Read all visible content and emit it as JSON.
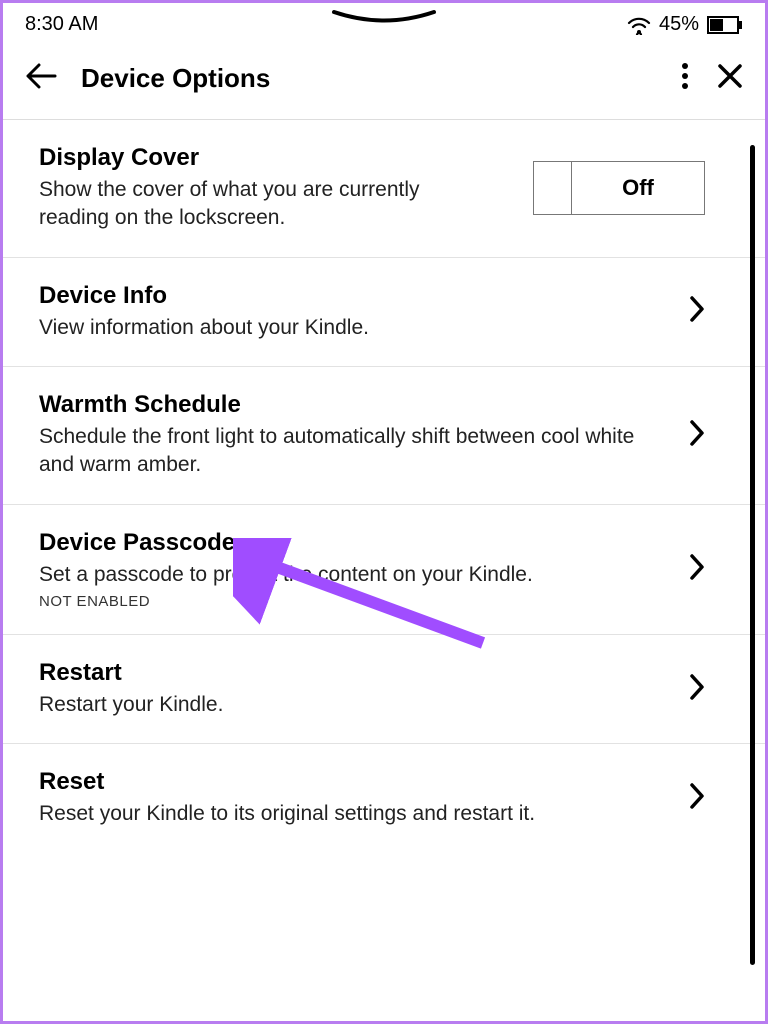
{
  "statusbar": {
    "time": "8:30 AM",
    "battery_pct": "45%"
  },
  "header": {
    "title": "Device Options"
  },
  "toggle": {
    "off_label": "Off"
  },
  "items": [
    {
      "title": "Display Cover",
      "desc": "Show the cover of what you are currently reading on the lockscreen."
    },
    {
      "title": "Device Info",
      "desc": "View information about your Kindle."
    },
    {
      "title": "Warmth Schedule",
      "desc": "Schedule the front light to automatically shift between cool white and warm amber."
    },
    {
      "title": "Device Passcode",
      "desc": "Set a passcode to protect the content on your Kindle.",
      "status": "NOT ENABLED"
    },
    {
      "title": "Restart",
      "desc": "Restart your Kindle."
    },
    {
      "title": "Reset",
      "desc": "Reset your Kindle to its original settings and restart it."
    }
  ]
}
